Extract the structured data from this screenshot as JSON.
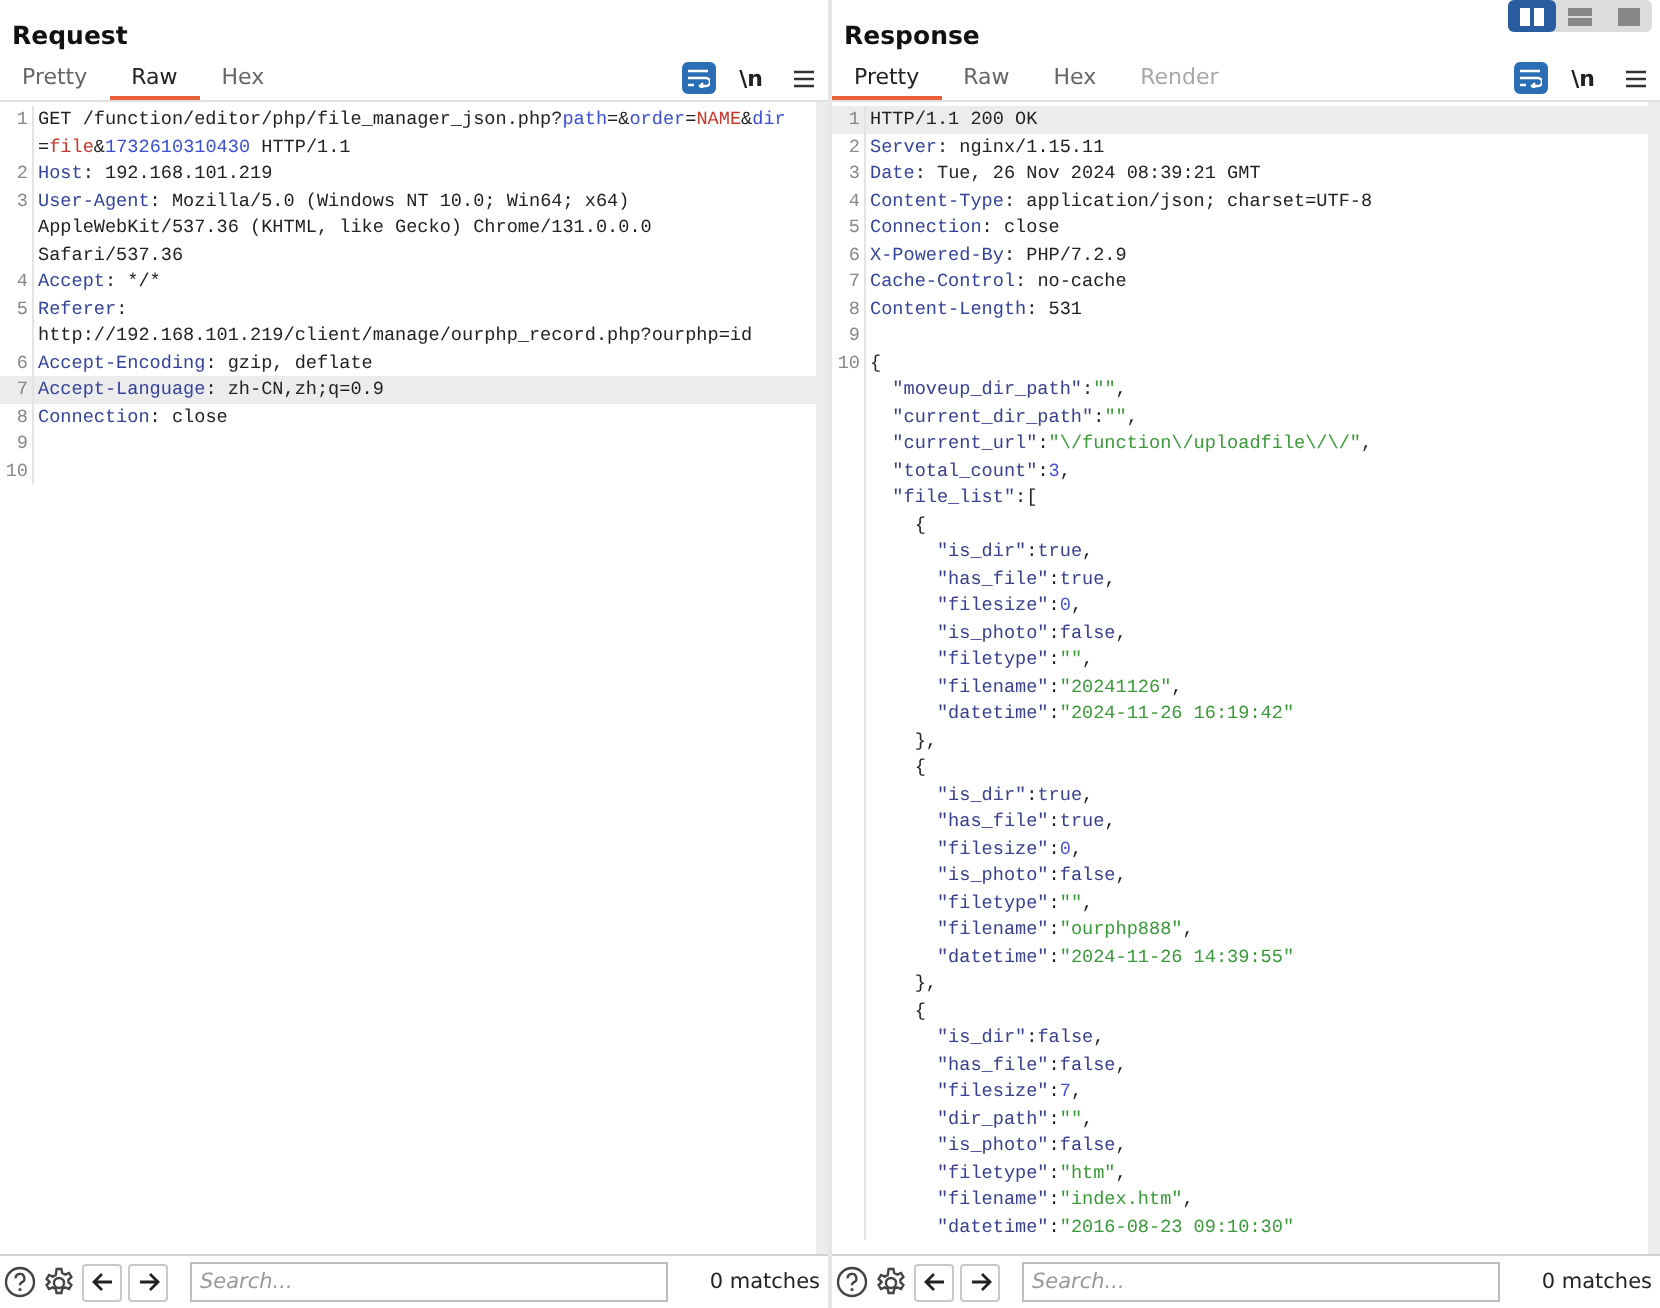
{
  "panels": [
    {
      "title": "Request",
      "tabs": [
        {
          "label": "Pretty",
          "selected": false,
          "disabled": false
        },
        {
          "label": "Raw",
          "selected": true,
          "disabled": false
        },
        {
          "label": "Hex",
          "selected": false,
          "disabled": false
        }
      ],
      "toolbar": {
        "wrap_selected": true,
        "newline_label": "\\n"
      },
      "rows": [
        {
          "number": "1",
          "highlighted": false,
          "tokens": [
            {
              "kind": "plain",
              "text": "GET /function/editor/php/file_manager_json.php?"
            },
            {
              "kind": "param",
              "text": "path"
            },
            {
              "kind": "plain",
              "text": "=&"
            },
            {
              "kind": "param",
              "text": "order"
            },
            {
              "kind": "plain",
              "text": "="
            },
            {
              "kind": "value",
              "text": "NAME"
            },
            {
              "kind": "plain",
              "text": "&"
            },
            {
              "kind": "param",
              "text": "dir"
            }
          ]
        },
        {
          "highlighted": false,
          "tokens": [
            {
              "kind": "plain",
              "text": "="
            },
            {
              "kind": "value",
              "text": "file"
            },
            {
              "kind": "plain",
              "text": "&"
            },
            {
              "kind": "param",
              "text": "1732610310430"
            },
            {
              "kind": "plain",
              "text": " HTTP/1.1"
            }
          ]
        },
        {
          "number": "2",
          "highlighted": false,
          "tokens": [
            {
              "kind": "header",
              "text": "Host"
            },
            {
              "kind": "plain",
              "text": ": 192.168.101.219"
            }
          ]
        },
        {
          "number": "3",
          "highlighted": false,
          "tokens": [
            {
              "kind": "header",
              "text": "User-Agent"
            },
            {
              "kind": "plain",
              "text": ": Mozilla/5.0 (Windows NT 10.0; Win64; x64)"
            }
          ]
        },
        {
          "highlighted": false,
          "tokens": [
            {
              "kind": "plain",
              "text": "AppleWebKit/537.36 (KHTML, like Gecko) Chrome/131.0.0.0"
            }
          ]
        },
        {
          "highlighted": false,
          "tokens": [
            {
              "kind": "plain",
              "text": "Safari/537.36"
            }
          ]
        },
        {
          "number": "4",
          "highlighted": false,
          "tokens": [
            {
              "kind": "header",
              "text": "Accept"
            },
            {
              "kind": "plain",
              "text": ": */*"
            }
          ]
        },
        {
          "number": "5",
          "highlighted": false,
          "tokens": [
            {
              "kind": "header",
              "text": "Referer"
            },
            {
              "kind": "plain",
              "text": ":"
            }
          ]
        },
        {
          "highlighted": false,
          "tokens": [
            {
              "kind": "plain",
              "text": "http://192.168.101.219/client/manage/ourphp_record.php?ourphp=id"
            }
          ]
        },
        {
          "number": "6",
          "highlighted": false,
          "tokens": [
            {
              "kind": "header",
              "text": "Accept-Encoding"
            },
            {
              "kind": "plain",
              "text": ": gzip, deflate"
            }
          ]
        },
        {
          "number": "7",
          "highlighted": true,
          "tokens": [
            {
              "kind": "header",
              "text": "Accept-Language"
            },
            {
              "kind": "plain",
              "text": ": zh-CN,zh;q=0.9"
            }
          ]
        },
        {
          "number": "8",
          "highlighted": false,
          "tokens": [
            {
              "kind": "header",
              "text": "Connection"
            },
            {
              "kind": "plain",
              "text": ": close"
            }
          ]
        },
        {
          "number": "9",
          "highlighted": false,
          "tokens": []
        },
        {
          "number": "10",
          "highlighted": false,
          "tokens": []
        }
      ],
      "search": {
        "placeholder": "Search...",
        "matches": "0 matches"
      }
    },
    {
      "title": "Response",
      "tabs": [
        {
          "label": "Pretty",
          "selected": true,
          "disabled": false
        },
        {
          "label": "Raw",
          "selected": false,
          "disabled": false
        },
        {
          "label": "Hex",
          "selected": false,
          "disabled": false
        },
        {
          "label": "Render",
          "selected": false,
          "disabled": true
        }
      ],
      "layout_buttons": [
        {
          "kind": "columns",
          "selected": true
        },
        {
          "kind": "rows",
          "selected": false
        },
        {
          "kind": "single",
          "selected": false
        }
      ],
      "toolbar": {
        "wrap_selected": true,
        "newline_label": "\\n"
      },
      "rows": [
        {
          "number": "1",
          "highlighted": true,
          "tokens": [
            {
              "kind": "plain",
              "text": "HTTP/1.1 200 OK"
            }
          ]
        },
        {
          "number": "2",
          "highlighted": false,
          "tokens": [
            {
              "kind": "header",
              "text": "Server"
            },
            {
              "kind": "plain",
              "text": ": nginx/1.15.11"
            }
          ]
        },
        {
          "number": "3",
          "highlighted": false,
          "tokens": [
            {
              "kind": "header",
              "text": "Date"
            },
            {
              "kind": "plain",
              "text": ": Tue, 26 Nov 2024 08:39:21 GMT"
            }
          ]
        },
        {
          "number": "4",
          "highlighted": false,
          "tokens": [
            {
              "kind": "header",
              "text": "Content-Type"
            },
            {
              "kind": "plain",
              "text": ": application/json; charset=UTF-8"
            }
          ]
        },
        {
          "number": "5",
          "highlighted": false,
          "tokens": [
            {
              "kind": "header",
              "text": "Connection"
            },
            {
              "kind": "plain",
              "text": ": close"
            }
          ]
        },
        {
          "number": "6",
          "highlighted": false,
          "tokens": [
            {
              "kind": "header",
              "text": "X-Powered-By"
            },
            {
              "kind": "plain",
              "text": ": PHP/7.2.9"
            }
          ]
        },
        {
          "number": "7",
          "highlighted": false,
          "tokens": [
            {
              "kind": "header",
              "text": "Cache-Control"
            },
            {
              "kind": "plain",
              "text": ": no-cache"
            }
          ]
        },
        {
          "number": "8",
          "highlighted": false,
          "tokens": [
            {
              "kind": "header",
              "text": "Content-Length"
            },
            {
              "kind": "plain",
              "text": ": 531"
            }
          ]
        },
        {
          "number": "9",
          "highlighted": false,
          "tokens": []
        },
        {
          "number": "10",
          "highlighted": false,
          "tokens": [
            {
              "kind": "plain",
              "text": "{"
            }
          ]
        },
        {
          "highlighted": false,
          "tokens": [
            {
              "kind": "key",
              "text": "  \"moveup_dir_path\""
            },
            {
              "kind": "plain",
              "text": ":"
            },
            {
              "kind": "string",
              "text": "\"\""
            },
            {
              "kind": "plain",
              "text": ","
            }
          ]
        },
        {
          "highlighted": false,
          "tokens": [
            {
              "kind": "key",
              "text": "  \"current_dir_path\""
            },
            {
              "kind": "plain",
              "text": ":"
            },
            {
              "kind": "string",
              "text": "\"\""
            },
            {
              "kind": "plain",
              "text": ","
            }
          ]
        },
        {
          "highlighted": false,
          "tokens": [
            {
              "kind": "key",
              "text": "  \"current_url\""
            },
            {
              "kind": "plain",
              "text": ":"
            },
            {
              "kind": "string",
              "text": "\"\\/function\\/uploadfile\\/\\/\""
            },
            {
              "kind": "plain",
              "text": ","
            }
          ]
        },
        {
          "highlighted": false,
          "tokens": [
            {
              "kind": "key",
              "text": "  \"total_count\""
            },
            {
              "kind": "plain",
              "text": ":"
            },
            {
              "kind": "number",
              "text": "3"
            },
            {
              "kind": "plain",
              "text": ","
            }
          ]
        },
        {
          "highlighted": false,
          "tokens": [
            {
              "kind": "key",
              "text": "  \"file_list\""
            },
            {
              "kind": "plain",
              "text": ":["
            }
          ]
        },
        {
          "highlighted": false,
          "tokens": [
            {
              "kind": "plain",
              "text": "    {"
            }
          ]
        },
        {
          "highlighted": false,
          "tokens": [
            {
              "kind": "key",
              "text": "      \"is_dir\""
            },
            {
              "kind": "plain",
              "text": ":"
            },
            {
              "kind": "literal",
              "text": "true"
            },
            {
              "kind": "plain",
              "text": ","
            }
          ]
        },
        {
          "highlighted": false,
          "tokens": [
            {
              "kind": "key",
              "text": "      \"has_file\""
            },
            {
              "kind": "plain",
              "text": ":"
            },
            {
              "kind": "literal",
              "text": "true"
            },
            {
              "kind": "plain",
              "text": ","
            }
          ]
        },
        {
          "highlighted": false,
          "tokens": [
            {
              "kind": "key",
              "text": "      \"filesize\""
            },
            {
              "kind": "plain",
              "text": ":"
            },
            {
              "kind": "number",
              "text": "0"
            },
            {
              "kind": "plain",
              "text": ","
            }
          ]
        },
        {
          "highlighted": false,
          "tokens": [
            {
              "kind": "key",
              "text": "      \"is_photo\""
            },
            {
              "kind": "plain",
              "text": ":"
            },
            {
              "kind": "literal",
              "text": "false"
            },
            {
              "kind": "plain",
              "text": ","
            }
          ]
        },
        {
          "highlighted": false,
          "tokens": [
            {
              "kind": "key",
              "text": "      \"filetype\""
            },
            {
              "kind": "plain",
              "text": ":"
            },
            {
              "kind": "string",
              "text": "\"\""
            },
            {
              "kind": "plain",
              "text": ","
            }
          ]
        },
        {
          "highlighted": false,
          "tokens": [
            {
              "kind": "key",
              "text": "      \"filename\""
            },
            {
              "kind": "plain",
              "text": ":"
            },
            {
              "kind": "string",
              "text": "\"20241126\""
            },
            {
              "kind": "plain",
              "text": ","
            }
          ]
        },
        {
          "highlighted": false,
          "tokens": [
            {
              "kind": "key",
              "text": "      \"datetime\""
            },
            {
              "kind": "plain",
              "text": ":"
            },
            {
              "kind": "string",
              "text": "\"2024-11-26 16:19:42\""
            }
          ]
        },
        {
          "highlighted": false,
          "tokens": [
            {
              "kind": "plain",
              "text": "    },"
            }
          ]
        },
        {
          "highlighted": false,
          "tokens": [
            {
              "kind": "plain",
              "text": "    {"
            }
          ]
        },
        {
          "highlighted": false,
          "tokens": [
            {
              "kind": "key",
              "text": "      \"is_dir\""
            },
            {
              "kind": "plain",
              "text": ":"
            },
            {
              "kind": "literal",
              "text": "true"
            },
            {
              "kind": "plain",
              "text": ","
            }
          ]
        },
        {
          "highlighted": false,
          "tokens": [
            {
              "kind": "key",
              "text": "      \"has_file\""
            },
            {
              "kind": "plain",
              "text": ":"
            },
            {
              "kind": "literal",
              "text": "true"
            },
            {
              "kind": "plain",
              "text": ","
            }
          ]
        },
        {
          "highlighted": false,
          "tokens": [
            {
              "kind": "key",
              "text": "      \"filesize\""
            },
            {
              "kind": "plain",
              "text": ":"
            },
            {
              "kind": "number",
              "text": "0"
            },
            {
              "kind": "plain",
              "text": ","
            }
          ]
        },
        {
          "highlighted": false,
          "tokens": [
            {
              "kind": "key",
              "text": "      \"is_photo\""
            },
            {
              "kind": "plain",
              "text": ":"
            },
            {
              "kind": "literal",
              "text": "false"
            },
            {
              "kind": "plain",
              "text": ","
            }
          ]
        },
        {
          "highlighted": false,
          "tokens": [
            {
              "kind": "key",
              "text": "      \"filetype\""
            },
            {
              "kind": "plain",
              "text": ":"
            },
            {
              "kind": "string",
              "text": "\"\""
            },
            {
              "kind": "plain",
              "text": ","
            }
          ]
        },
        {
          "highlighted": false,
          "tokens": [
            {
              "kind": "key",
              "text": "      \"filename\""
            },
            {
              "kind": "plain",
              "text": ":"
            },
            {
              "kind": "string",
              "text": "\"ourphp888\""
            },
            {
              "kind": "plain",
              "text": ","
            }
          ]
        },
        {
          "highlighted": false,
          "tokens": [
            {
              "kind": "key",
              "text": "      \"datetime\""
            },
            {
              "kind": "plain",
              "text": ":"
            },
            {
              "kind": "string",
              "text": "\"2024-11-26 14:39:55\""
            }
          ]
        },
        {
          "highlighted": false,
          "tokens": [
            {
              "kind": "plain",
              "text": "    },"
            }
          ]
        },
        {
          "highlighted": false,
          "tokens": [
            {
              "kind": "plain",
              "text": "    {"
            }
          ]
        },
        {
          "highlighted": false,
          "tokens": [
            {
              "kind": "key",
              "text": "      \"is_dir\""
            },
            {
              "kind": "plain",
              "text": ":"
            },
            {
              "kind": "literal",
              "text": "false"
            },
            {
              "kind": "plain",
              "text": ","
            }
          ]
        },
        {
          "highlighted": false,
          "tokens": [
            {
              "kind": "key",
              "text": "      \"has_file\""
            },
            {
              "kind": "plain",
              "text": ":"
            },
            {
              "kind": "literal",
              "text": "false"
            },
            {
              "kind": "plain",
              "text": ","
            }
          ]
        },
        {
          "highlighted": false,
          "tokens": [
            {
              "kind": "key",
              "text": "      \"filesize\""
            },
            {
              "kind": "plain",
              "text": ":"
            },
            {
              "kind": "number",
              "text": "7"
            },
            {
              "kind": "plain",
              "text": ","
            }
          ]
        },
        {
          "highlighted": false,
          "tokens": [
            {
              "kind": "key",
              "text": "      \"dir_path\""
            },
            {
              "kind": "plain",
              "text": ":"
            },
            {
              "kind": "string",
              "text": "\"\""
            },
            {
              "kind": "plain",
              "text": ","
            }
          ]
        },
        {
          "highlighted": false,
          "tokens": [
            {
              "kind": "key",
              "text": "      \"is_photo\""
            },
            {
              "kind": "plain",
              "text": ":"
            },
            {
              "kind": "literal",
              "text": "false"
            },
            {
              "kind": "plain",
              "text": ","
            }
          ]
        },
        {
          "highlighted": false,
          "tokens": [
            {
              "kind": "key",
              "text": "      \"filetype\""
            },
            {
              "kind": "plain",
              "text": ":"
            },
            {
              "kind": "string",
              "text": "\"htm\""
            },
            {
              "kind": "plain",
              "text": ","
            }
          ]
        },
        {
          "highlighted": false,
          "tokens": [
            {
              "kind": "key",
              "text": "      \"filename\""
            },
            {
              "kind": "plain",
              "text": ":"
            },
            {
              "kind": "string",
              "text": "\"index.htm\""
            },
            {
              "kind": "plain",
              "text": ","
            }
          ]
        },
        {
          "highlighted": false,
          "tokens": [
            {
              "kind": "key",
              "text": "      \"datetime\""
            },
            {
              "kind": "plain",
              "text": ":"
            },
            {
              "kind": "string",
              "text": "\"2016-08-23 09:10:30\""
            }
          ]
        }
      ],
      "search": {
        "placeholder": "Search...",
        "matches": "0 matches"
      }
    }
  ]
}
